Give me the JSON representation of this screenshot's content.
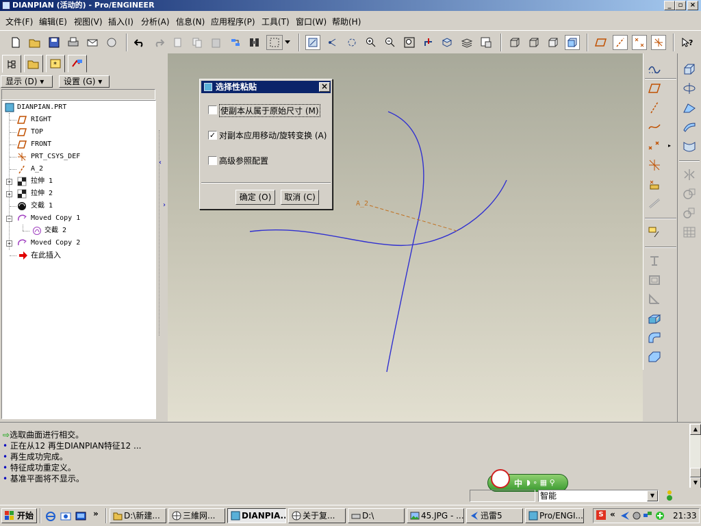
{
  "window": {
    "title": "DIANPIAN (活动的) - Pro/ENGINEER",
    "minimize_label": "_",
    "restore_label": "▫",
    "close_label": "×"
  },
  "menubar": {
    "items": [
      "文件(F)",
      "编辑(E)",
      "视图(V)",
      "插入(I)",
      "分析(A)",
      "信息(N)",
      "应用程序(P)",
      "工具(T)",
      "窗口(W)",
      "帮助(H)"
    ]
  },
  "left_panel": {
    "display_button": "显示 (D) ▾",
    "settings_button": "设置 (G) ▾",
    "tree": [
      {
        "label": "DIANPIAN.PRT",
        "icon": "part-icon"
      },
      {
        "label": "RIGHT",
        "icon": "datum-plane-icon"
      },
      {
        "label": "TOP",
        "icon": "datum-plane-icon"
      },
      {
        "label": "FRONT",
        "icon": "datum-plane-icon"
      },
      {
        "label": "PRT_CSYS_DEF",
        "icon": "csys-icon"
      },
      {
        "label": "A_2",
        "icon": "datum-axis-icon"
      },
      {
        "label": "拉伸 1",
        "icon": "extrude-icon"
      },
      {
        "label": "拉伸 2",
        "icon": "extrude-icon"
      },
      {
        "label": "交截 1",
        "icon": "intersect-icon"
      },
      {
        "label": "Moved Copy 1",
        "icon": "moved-copy-icon"
      },
      {
        "label": "交截 2",
        "icon": "intersect-curve-icon"
      },
      {
        "label": "Moved Copy 2",
        "icon": "moved-copy-icon"
      },
      {
        "label": "在此插入",
        "icon": "insert-here-arrow-icon"
      }
    ]
  },
  "dialog": {
    "title": "选择性粘贴",
    "options": [
      {
        "label": "使副本从属于原始尺寸 (M)",
        "checked": false
      },
      {
        "label": "对副本应用移动/旋转变换 (A)",
        "checked": true
      },
      {
        "label": "高级参照配置",
        "checked": false
      }
    ],
    "ok_label": "确定 (O)",
    "cancel_label": "取消 (C)",
    "close_label": "×"
  },
  "viewport": {
    "axis_label": "A_2"
  },
  "messages": [
    {
      "text": "选取曲面进行相交。",
      "type": "prompt"
    },
    {
      "text": "正在从12 再生DIANPIAN特征12 ...",
      "type": "info"
    },
    {
      "text": "再生成功完成。",
      "type": "info"
    },
    {
      "text": "特征成功重定义。",
      "type": "info"
    },
    {
      "text": "基准平面将不显示。",
      "type": "info"
    }
  ],
  "status": {
    "filter_value": "智能",
    "ime_label": "中"
  },
  "taskbar": {
    "start_label": "开始",
    "tasks": [
      "D:\\新建...",
      "三維网...",
      "DIANPIA...",
      "关于复...",
      "D:\\",
      "45.JPG - ...",
      "迅雷5",
      "Pro/ENGI..."
    ],
    "clock": "21:33"
  },
  "colors": {
    "title_bar": "#0a246a",
    "curve": "#3030d0",
    "axis": "#c07020",
    "selected_task": "#e8e8e8"
  }
}
